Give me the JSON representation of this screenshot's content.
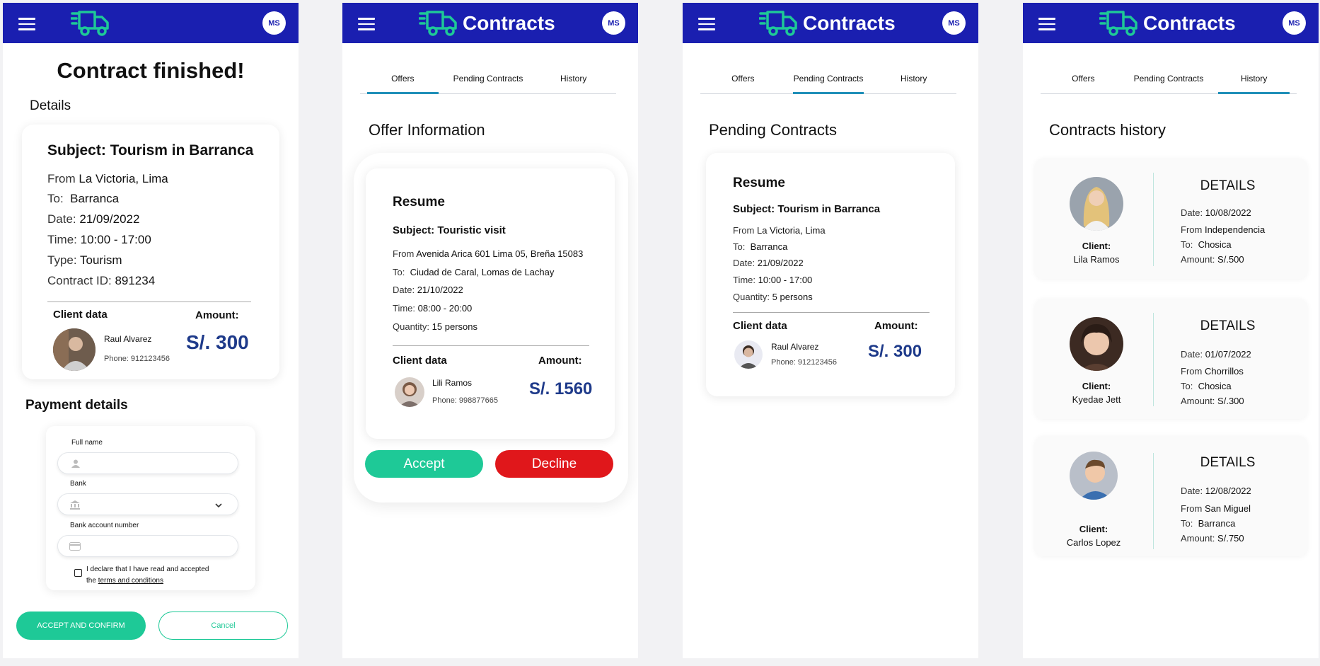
{
  "colors": {
    "appbar": "#1a1fb0",
    "accent": "#1ec997",
    "decline": "#e0171b",
    "amount": "#1e3a8a",
    "tab_indicator": "#1f8fb8"
  },
  "common": {
    "app_title": "Contracts",
    "avatar_initials": "MS",
    "menu_icon": "hamburger-icon",
    "logo_icon": "delivery-truck-icon"
  },
  "tabs": [
    "Offers",
    "Pending Contracts",
    "History"
  ],
  "screen1": {
    "title": "Contract finished!",
    "details_heading": "Details",
    "subject": "Subject: Tourism in Barranca",
    "from_label": "From",
    "from_value": "La Victoria, Lima",
    "to_label": "To:",
    "to_value": "Barranca",
    "date_label": "Date:",
    "date_value": "21/09/2022",
    "time_label": "Time:",
    "time_value": "10:00 - 17:00",
    "type_label": "Type:",
    "type_value": "Tourism",
    "contract_label": "Contract ID:",
    "contract_value": "891234",
    "client_data_label": "Client data",
    "amount_label": "Amount:",
    "client_name": "Raul Alvarez",
    "client_phone": "Phone: 912123456",
    "amount": "S/. 300",
    "payment_heading": "Payment details",
    "fullname_label": "Full name",
    "bank_label": "Bank",
    "account_label": "Bank account number",
    "terms_prefix": "I declare that I have read and accepted",
    "terms_the": "the",
    "terms_link": "terms and conditions",
    "accept_button": "ACCEPT AND CONFIRM",
    "cancel_button": "Cancel"
  },
  "screen2": {
    "heading": "Offer Information",
    "resume": "Resume",
    "subject": "Subject: Touristic visit",
    "from_label": "From",
    "from_value": "Avenida Arica 601 Lima 05, Breña 15083",
    "to_label": "To:",
    "to_value": "Ciudad de Caral, Lomas de Lachay",
    "date_label": "Date:",
    "date_value": "21/10/2022",
    "time_label": "Time:",
    "time_value": "08:00 - 20:00",
    "quantity_label": "Quantity:",
    "quantity_value": "15 persons",
    "client_data_label": "Client data",
    "amount_label": "Amount:",
    "client_name": "Lili Ramos",
    "client_phone": "Phone: 998877665",
    "amount": "S/. 1560",
    "accept_button": "Accept",
    "decline_button": "Decline"
  },
  "screen3": {
    "heading": "Pending Contracts",
    "resume": "Resume",
    "subject": "Subject: Tourism in Barranca",
    "from_label": "From",
    "from_value": "La Victoria, Lima",
    "to_label": "To:",
    "to_value": "Barranca",
    "date_label": "Date:",
    "date_value": "21/09/2022",
    "time_label": "Time:",
    "time_value": "10:00 - 17:00",
    "quantity_label": "Quantity:",
    "quantity_value": "5 persons",
    "client_data_label": "Client data",
    "amount_label": "Amount:",
    "client_name": "Raul Alvarez",
    "client_phone": "Phone: 912123456",
    "amount": "S/. 300"
  },
  "screen4": {
    "heading": "Contracts history",
    "client_label": "Client:",
    "details_label": "DETAILS",
    "date_label": "Date:",
    "from_label": "From",
    "to_label": "To:",
    "amount_label": "Amount:",
    "items": [
      {
        "client": "Lila Ramos",
        "date": "10/08/2022",
        "from": "Independencia",
        "to": "Chosica",
        "amount": "S/.500"
      },
      {
        "client": "Kyedae Jett",
        "date": "01/07/2022",
        "from": "Chorrillos",
        "to": "Chosica",
        "amount": "S/.300"
      },
      {
        "client": "Carlos Lopez",
        "date": "12/08/2022",
        "from": "San Miguel",
        "to": "Barranca",
        "amount": "S/.750"
      }
    ]
  }
}
